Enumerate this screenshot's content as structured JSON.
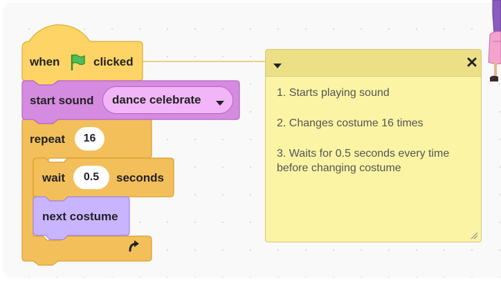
{
  "colors": {
    "events": "#ffd466",
    "sound": "#d58ce0",
    "control": "#f3bf5a",
    "looks": "#c9b4ff",
    "comment_bg": "#fbf4a4",
    "comment_header": "#ece087"
  },
  "script": {
    "hat_block": {
      "label_when": "when",
      "flag_icon": "green-flag-icon",
      "label_clicked": "clicked"
    },
    "sound_block": {
      "label": "start sound",
      "sound_name": "dance celebrate"
    },
    "repeat_block": {
      "label": "repeat",
      "times": "16"
    },
    "wait_block": {
      "label_wait": "wait",
      "value": "0.5",
      "label_seconds": "seconds"
    },
    "costume_block": {
      "label": "next costume"
    },
    "loop_arrow_icon": "loop-arrow-icon"
  },
  "comment": {
    "lines": [
      "1. Starts playing sound",
      "2. Changes costume 16 times",
      "3. Waits for 0.5 seconds every time before changing costume"
    ]
  }
}
